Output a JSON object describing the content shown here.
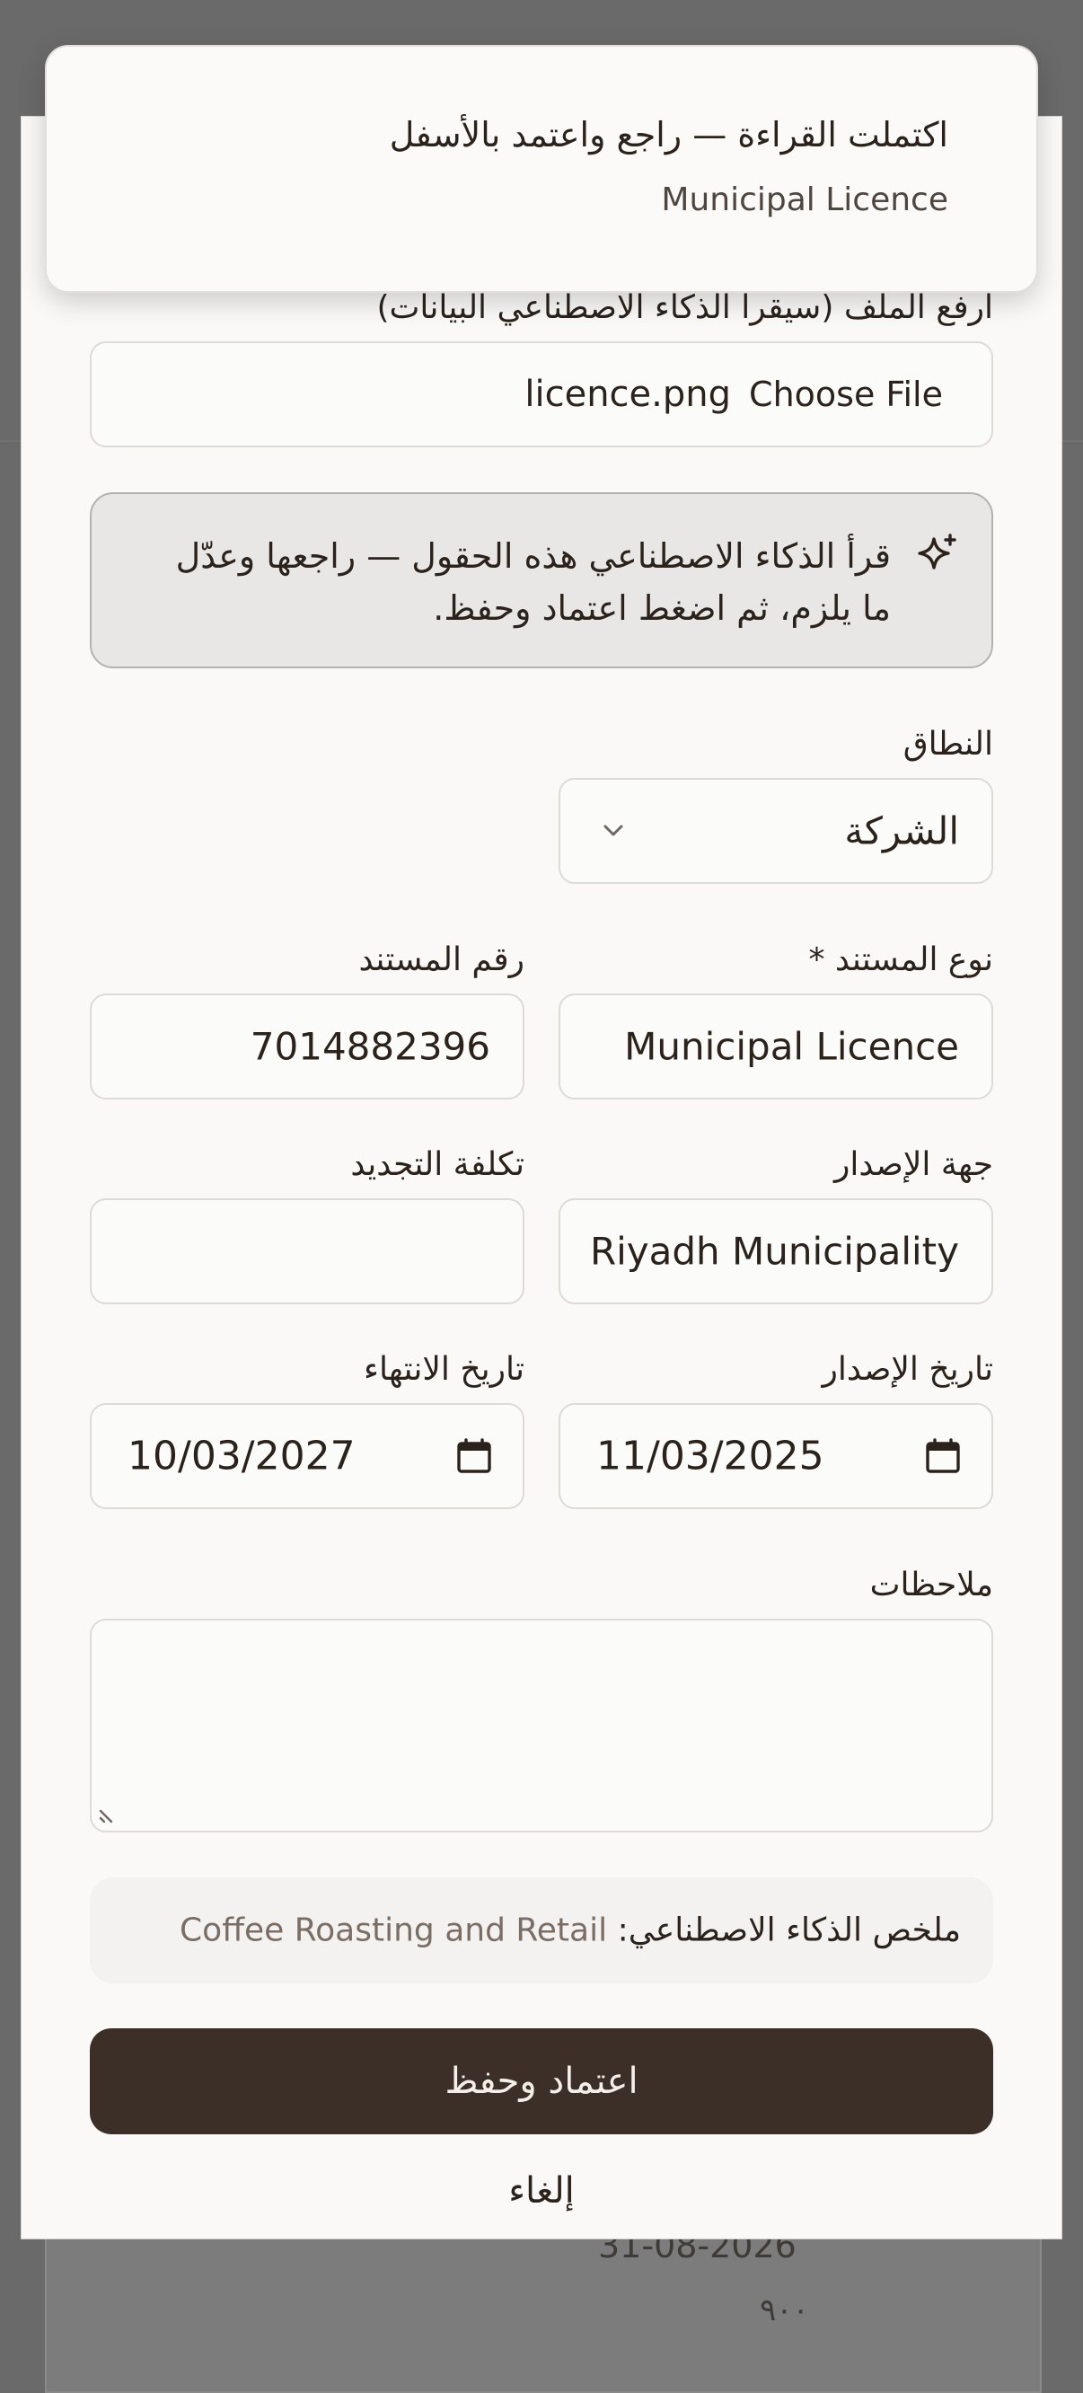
{
  "background": {
    "date": "31-08-2026",
    "amount": "٩٠٠"
  },
  "toast": {
    "title": "اكتملت القراءة — راجع واعتمد بالأسفل",
    "subtitle": "Municipal Licence"
  },
  "upload": {
    "label": "ارفع الملف (سيقرأ الذكاء الاصطناعي البيانات)",
    "file_name": "licence.png",
    "choose_label": "Choose File"
  },
  "notice": {
    "icon": "sparkle-icon",
    "text": "قرأ الذكاء الاصطناعي هذه الحقول — راجعها وعدّل ما يلزم، ثم اضغط اعتماد وحفظ."
  },
  "scope": {
    "label": "النطاق",
    "value": "الشركة"
  },
  "doc_type": {
    "label": "نوع المستند *",
    "value": "Municipal Licence"
  },
  "doc_number": {
    "label": "رقم المستند",
    "value": "7014882396"
  },
  "issuer": {
    "label": "جهة الإصدار",
    "value": "Riyadh Municipality"
  },
  "renewal_cost": {
    "label": "تكلفة التجديد",
    "value": ""
  },
  "issue_date": {
    "label": "تاريخ الإصدار",
    "value": "11/03/2025"
  },
  "expiry_date": {
    "label": "تاريخ الانتهاء",
    "value": "10/03/2027"
  },
  "notes": {
    "label": "ملاحظات",
    "value": ""
  },
  "summary": {
    "label": "ملخص الذكاء الاصطناعي:",
    "value": "Coffee Roasting and Retail"
  },
  "actions": {
    "approve_label": "اعتماد وحفظ",
    "cancel_label": "إلغاء"
  },
  "colors": {
    "primary": "#3b2f27",
    "sheet": "#faf9f7",
    "overlay": "#6a6a6a"
  }
}
